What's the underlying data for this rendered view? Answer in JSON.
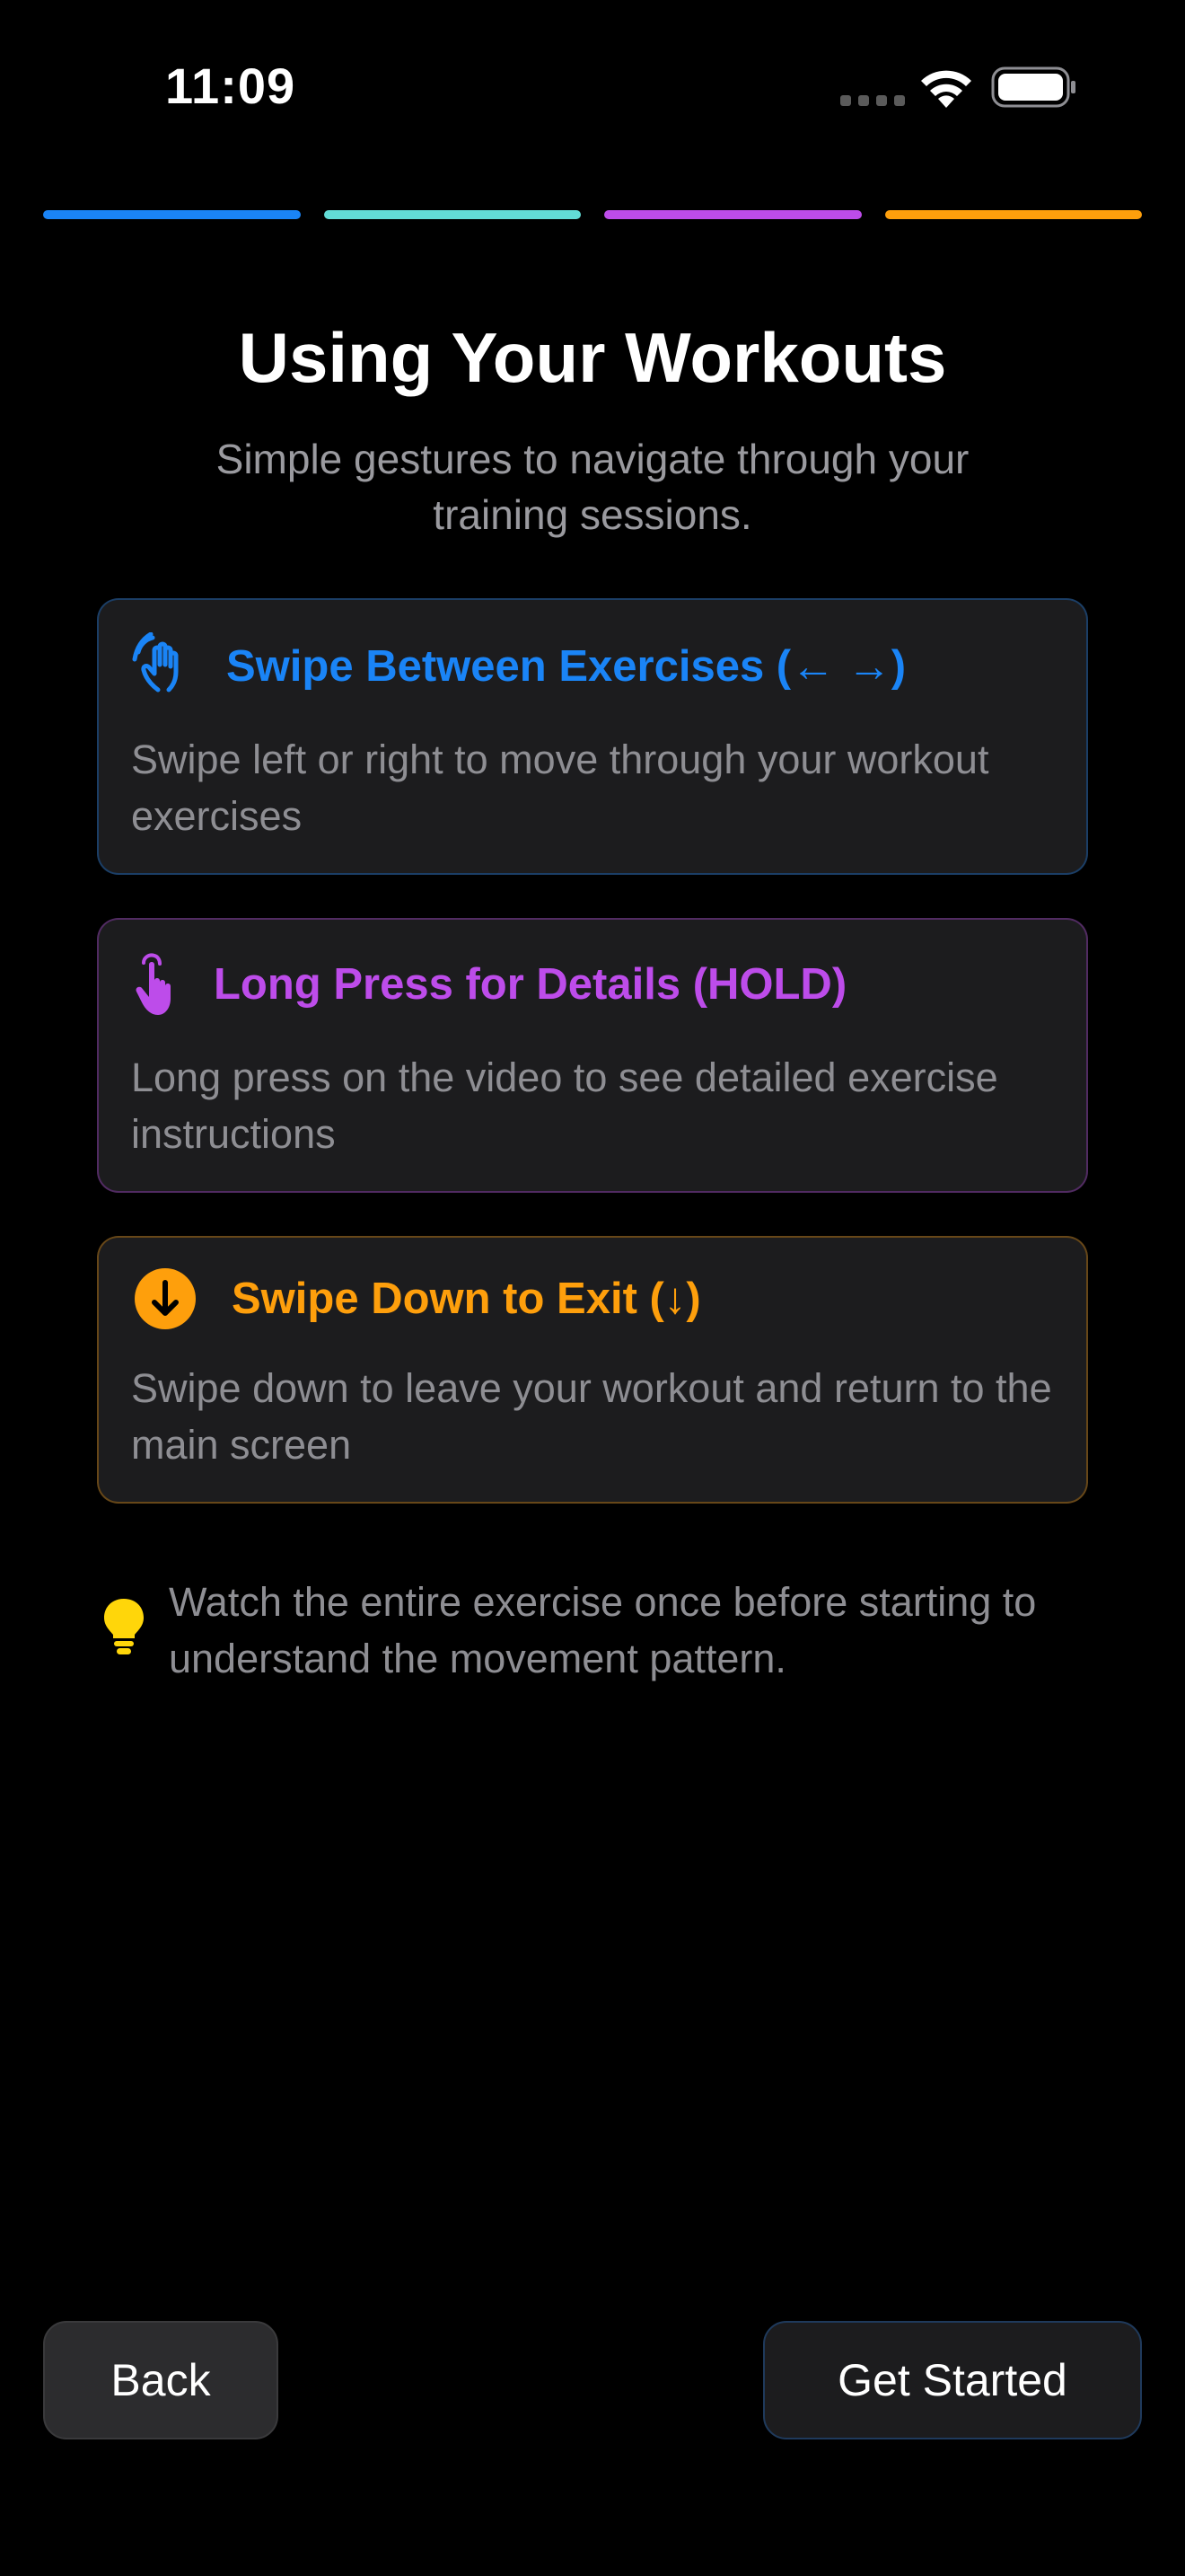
{
  "status_bar": {
    "time": "11:09"
  },
  "progress": {
    "segments": [
      {
        "color": "#1a84f6"
      },
      {
        "color": "#62dcd6"
      },
      {
        "color": "#bd4cea"
      },
      {
        "color": "#fe9f0c"
      }
    ]
  },
  "header": {
    "title": "Using Your Workouts",
    "subtitle": "Simple gestures to navigate through your training sessions."
  },
  "gestures": [
    {
      "icon": "swipe-hand-icon",
      "title": "Swipe Between Exercises (← →)",
      "description": "Swipe left or right to move through your workout exercises",
      "color": "#1a84f6"
    },
    {
      "icon": "press-hand-icon",
      "title": "Long Press for Details (HOLD)",
      "description": "Long press on the video to see detailed exercise instructions",
      "color": "#bd4cea"
    },
    {
      "icon": "arrow-down-circle-icon",
      "title": "Swipe Down to Exit (↓)",
      "description": "Swipe down to leave your workout and return to the main screen",
      "color": "#fe9f0c"
    }
  ],
  "tip": {
    "icon": "lightbulb-icon",
    "text": "Watch the entire exercise once before starting to understand the movement pattern.",
    "color": "#ffd60a"
  },
  "buttons": {
    "back_label": "Back",
    "start_label": "Get Started"
  }
}
